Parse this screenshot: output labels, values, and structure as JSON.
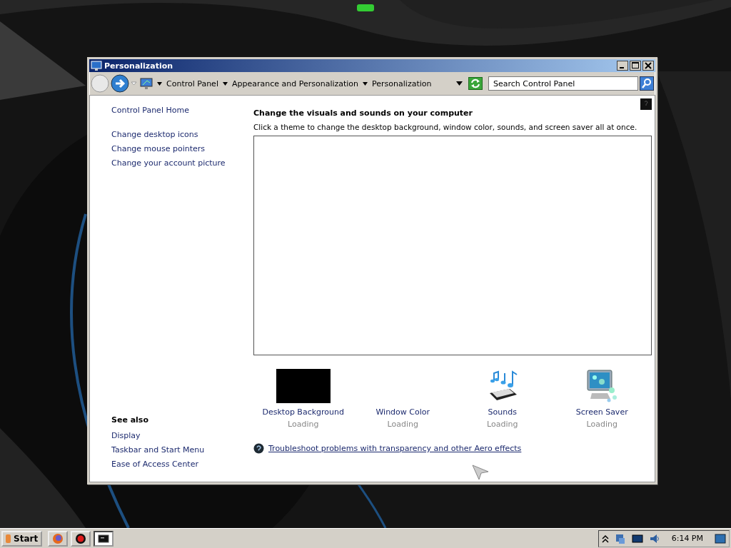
{
  "window": {
    "title": "Personalization"
  },
  "address_bar": {
    "crumbs": [
      "Control Panel",
      "Appearance and Personalization",
      "Personalization"
    ]
  },
  "search": {
    "placeholder": "Search Control Panel"
  },
  "sidebar": {
    "home": "Control Panel Home",
    "links": [
      "Change desktop icons",
      "Change mouse pointers",
      "Change your account picture"
    ],
    "see_also": {
      "heading": "See also",
      "links": [
        "Display",
        "Taskbar and Start Menu",
        "Ease of Access Center"
      ]
    }
  },
  "main": {
    "heading": "Change the visuals and sounds on your computer",
    "description": "Click a theme to change the desktop background, window color, sounds, and screen saver all at once.",
    "items": [
      {
        "kind": "swatch",
        "label": "Desktop Background",
        "status": "Loading"
      },
      {
        "kind": "none",
        "label": "Window Color",
        "status": "Loading"
      },
      {
        "kind": "sounds",
        "label": "Sounds",
        "status": "Loading"
      },
      {
        "kind": "screensaver",
        "label": "Screen Saver",
        "status": "Loading"
      }
    ],
    "help_link": "Troubleshoot problems with transparency and other Aero effects"
  },
  "taskbar": {
    "start": "Start",
    "buttons": [
      {
        "kind": "browser",
        "selected": false
      },
      {
        "kind": "record",
        "selected": false
      },
      {
        "kind": "terminal",
        "selected": true
      }
    ],
    "clock": "6:14 PM"
  }
}
